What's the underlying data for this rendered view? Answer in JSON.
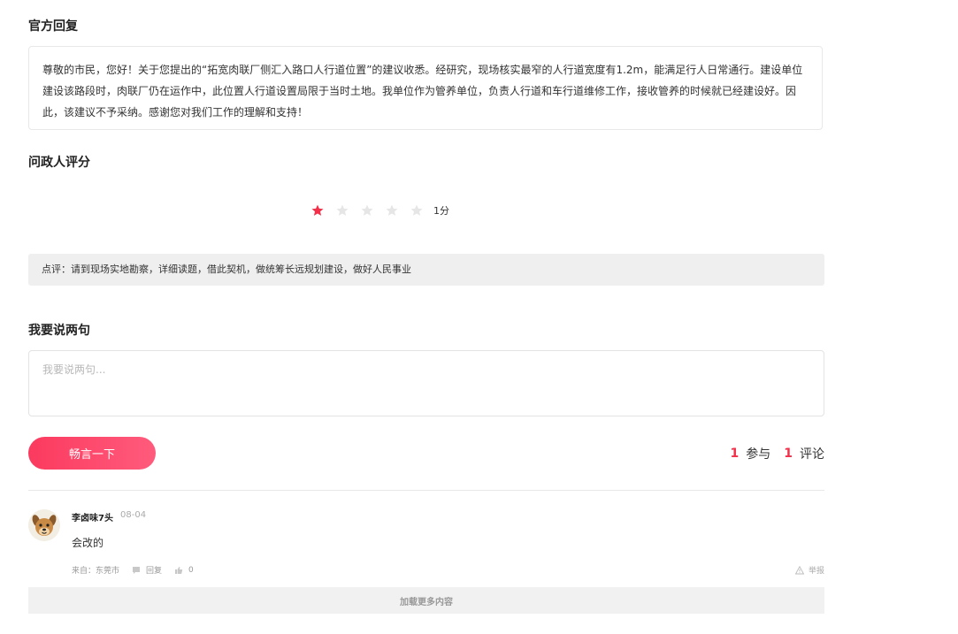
{
  "official_reply": {
    "title": "官方回复",
    "content": "尊敬的市民，您好！关于您提出的“拓宽肉联厂侧汇入路口人行道位置”的建议收悉。经研究，现场核实最窄的人行道宽度有1.2m，能满足行人日常通行。建设单位建设该路段时，肉联厂仍在运作中，此位置人行道设置局限于当时土地。我单位作为管养单位，负责人行道和车行道维修工作，接收管养的时候就已经建设好。因此，该建议不予采纳。感谢您对我们工作的理解和支持！"
  },
  "rating": {
    "title": "问政人评分",
    "stars_total": 5,
    "stars_filled": 1,
    "score_label": "1分",
    "filled_color": "#f23049",
    "empty_color": "#e6e6e6",
    "remark": "点评：请到现场实地勘察，详细读题，借此契机，做统筹长远规划建设，做好人民事业"
  },
  "say": {
    "title": "我要说两句",
    "placeholder": "我要说两句...",
    "value": "",
    "submit_label": "畅言一下"
  },
  "stats": {
    "participants": "1",
    "participants_label": "参与",
    "comments": "1",
    "comments_label": "评论"
  },
  "comments": [
    {
      "user": "李卤味7头",
      "date": "08-04",
      "text": "会改的",
      "source": "来自：东莞市",
      "reply_label": "回复",
      "likes": "0",
      "report_label": "举报",
      "avatar_icon": "dog-avatar"
    }
  ],
  "load_more_label": "加载更多内容",
  "colors": {
    "accent": "#f23049",
    "button_gradient_start": "#fb3a5f",
    "button_gradient_end": "#ff5b7c"
  }
}
